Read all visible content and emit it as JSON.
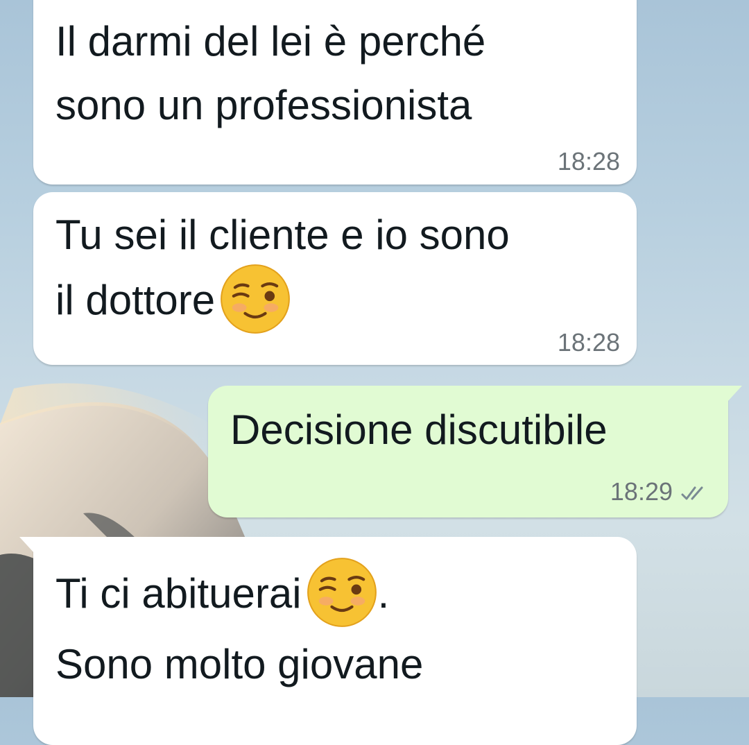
{
  "messages": [
    {
      "direction": "incoming",
      "lines": [
        "Il darmi del lei è perché",
        "sono un professionista"
      ],
      "time": "18:28"
    },
    {
      "direction": "incoming",
      "lines": [
        "Tu sei il cliente e io sono",
        "il dottore"
      ],
      "emoji": "winking-blush-emoji",
      "time": "18:28"
    },
    {
      "direction": "outgoing",
      "lines": [
        "Decisione discutibile"
      ],
      "time": "18:29",
      "status": "read-double-check"
    },
    {
      "direction": "incoming",
      "lines": [
        "Ti ci abituerai",
        "Sono molto giovane"
      ],
      "line1_suffix": ".",
      "emoji": "winking-blush-emoji"
    }
  ],
  "colors": {
    "incoming_bubble": "#ffffff",
    "outgoing_bubble": "#e1fbd3",
    "text": "#121a1f",
    "timestamp": "#6b7378",
    "read_ticks": "#7a8a93"
  }
}
